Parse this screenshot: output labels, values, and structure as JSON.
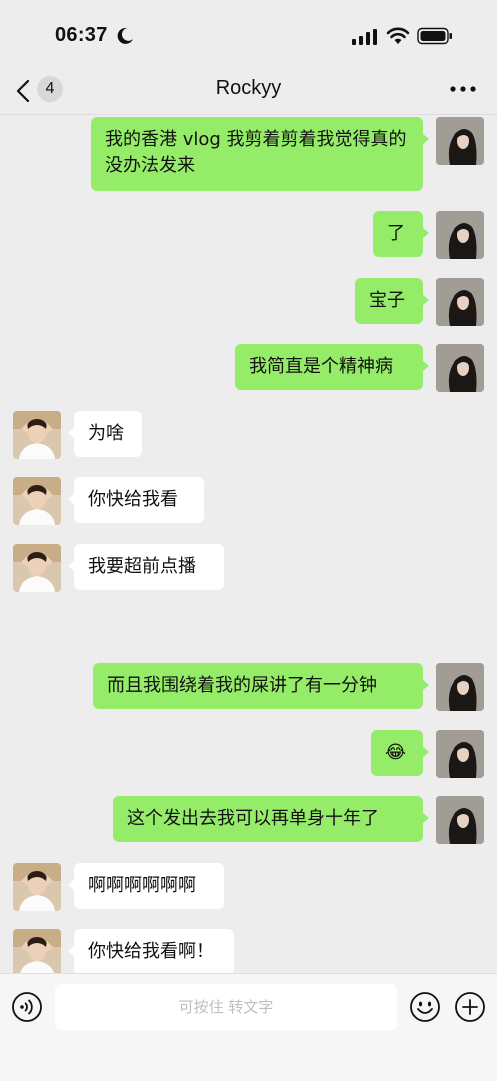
{
  "status": {
    "time": "06:37"
  },
  "nav": {
    "back_badge": "4",
    "title": "Rockyy"
  },
  "messages": [
    {
      "side": "right",
      "text": "我的香港 vlog 我剪着剪着我觉得真的没办法发来",
      "avatar": "user-avatar"
    },
    {
      "side": "right",
      "text": "了",
      "avatar": "user-avatar"
    },
    {
      "side": "right",
      "text": "宝子",
      "avatar": "user-avatar"
    },
    {
      "side": "right",
      "text": "我简直是个精神病",
      "avatar": "user-avatar"
    },
    {
      "side": "left",
      "text": "为啥",
      "avatar": "friend-avatar"
    },
    {
      "side": "left",
      "text": "你快给我看",
      "avatar": "friend-avatar"
    },
    {
      "side": "left",
      "text": "我要超前点播",
      "avatar": "friend-avatar"
    },
    {
      "side": "right",
      "text": "而且我围绕着我的屎讲了有一分钟",
      "avatar": "user-avatar"
    },
    {
      "side": "right",
      "text": "😂",
      "avatar": "user-avatar"
    },
    {
      "side": "right",
      "text": "这个发出去我可以再单身十年了",
      "avatar": "user-avatar"
    },
    {
      "side": "left",
      "text": "啊啊啊啊啊啊",
      "avatar": "friend-avatar"
    },
    {
      "side": "left",
      "text": "你快给我看啊！",
      "avatar": "friend-avatar"
    }
  ],
  "input": {
    "placeholder": "可按住 转文字"
  },
  "icons": {
    "voice": "voice-icon",
    "emoji": "emoji-icon",
    "plus": "plus-icon",
    "back": "back-chevron-icon",
    "more": "more-icon"
  },
  "colors": {
    "bg": "#ededed",
    "sent_bubble": "#95ec69",
    "received_bubble": "#ffffff"
  }
}
